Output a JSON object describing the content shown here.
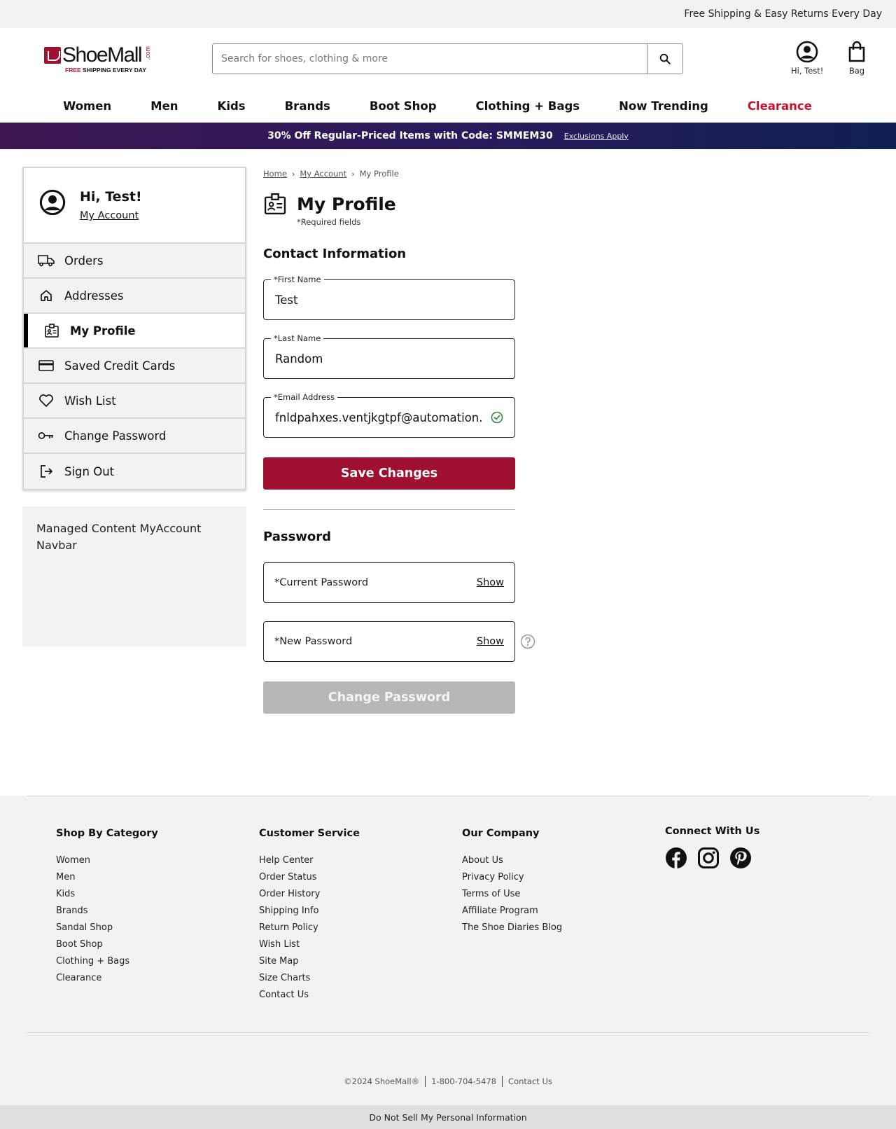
{
  "topbar": {
    "text": "Free Shipping & Easy Returns Every Day"
  },
  "logo": {
    "name": "ShoeMall",
    "com": ".com",
    "tag_free": "FREE",
    "tag_rest": " SHIPPING EVERY DAY"
  },
  "search": {
    "placeholder": "Search for shoes, clothing & more",
    "icon": "search-icon"
  },
  "header": {
    "account_label": "Hi, Test!",
    "bag_label": "Bag"
  },
  "nav": {
    "items": [
      "Women",
      "Men",
      "Kids",
      "Brands",
      "Boot Shop",
      "Clothing + Bags",
      "Now Trending",
      "Clearance"
    ]
  },
  "promo": {
    "text": "30% Off Regular-Priced Items with Code: SMMEM30",
    "link": "Exclusions Apply"
  },
  "sidebar": {
    "greeting": "Hi, Test!",
    "account_link": "My Account",
    "items": [
      {
        "label": "Orders",
        "icon": "truck-icon"
      },
      {
        "label": "Addresses",
        "icon": "home-icon"
      },
      {
        "label": "My Profile",
        "icon": "profile-badge-icon",
        "active": true
      },
      {
        "label": "Saved Credit Cards",
        "icon": "credit-card-icon"
      },
      {
        "label": "Wish List",
        "icon": "heart-icon"
      },
      {
        "label": "Change Password",
        "icon": "key-icon"
      },
      {
        "label": "Sign Out",
        "icon": "sign-out-icon"
      }
    ],
    "managed_content": "Managed Content MyAccount Navbar"
  },
  "breadcrumb": {
    "home": "Home",
    "account": "My Account",
    "current": "My Profile"
  },
  "profile": {
    "title": "My Profile",
    "required_note": "*Required fields",
    "contact_heading": "Contact Information",
    "first_name_label": "*First Name",
    "first_name_value": "Test",
    "last_name_label": "*Last Name",
    "last_name_value": "Random",
    "email_label": "*Email Address",
    "email_value": "fnldpahxes.ventjkgtpf@automation.",
    "save_button": "Save Changes",
    "password_heading": "Password",
    "current_password_placeholder": "*Current Password",
    "new_password_placeholder": "*New Password",
    "show_label": "Show",
    "change_button": "Change Password"
  },
  "footer": {
    "shop": {
      "heading": "Shop By Category",
      "links": [
        "Women",
        "Men",
        "Kids",
        "Brands",
        "Sandal Shop",
        "Boot Shop",
        "Clothing + Bags",
        "Clearance"
      ]
    },
    "service": {
      "heading": "Customer Service",
      "links": [
        "Help Center",
        "Order Status",
        "Order History",
        "Shipping Info",
        "Return Policy",
        "Wish List",
        "Site Map",
        "Size Charts",
        "Contact Us"
      ]
    },
    "company": {
      "heading": "Our Company",
      "links": [
        "About Us",
        "Privacy Policy",
        "Terms of Use",
        "Affiliate Program",
        "The Shoe Diaries Blog"
      ]
    },
    "connect": {
      "heading": "Connect With Us",
      "icons": [
        "facebook-icon",
        "instagram-icon",
        "pinterest-icon"
      ]
    },
    "copyright": "©2024 ShoeMall®",
    "phone": "1-800-704-5478",
    "contact": "Contact Us",
    "do_not_sell": "Do Not Sell My Personal Information"
  },
  "colors": {
    "brand": "#a01030",
    "clearance": "#c8102e",
    "success": "#2e8b3d",
    "disabled": "#b7b7b7"
  }
}
